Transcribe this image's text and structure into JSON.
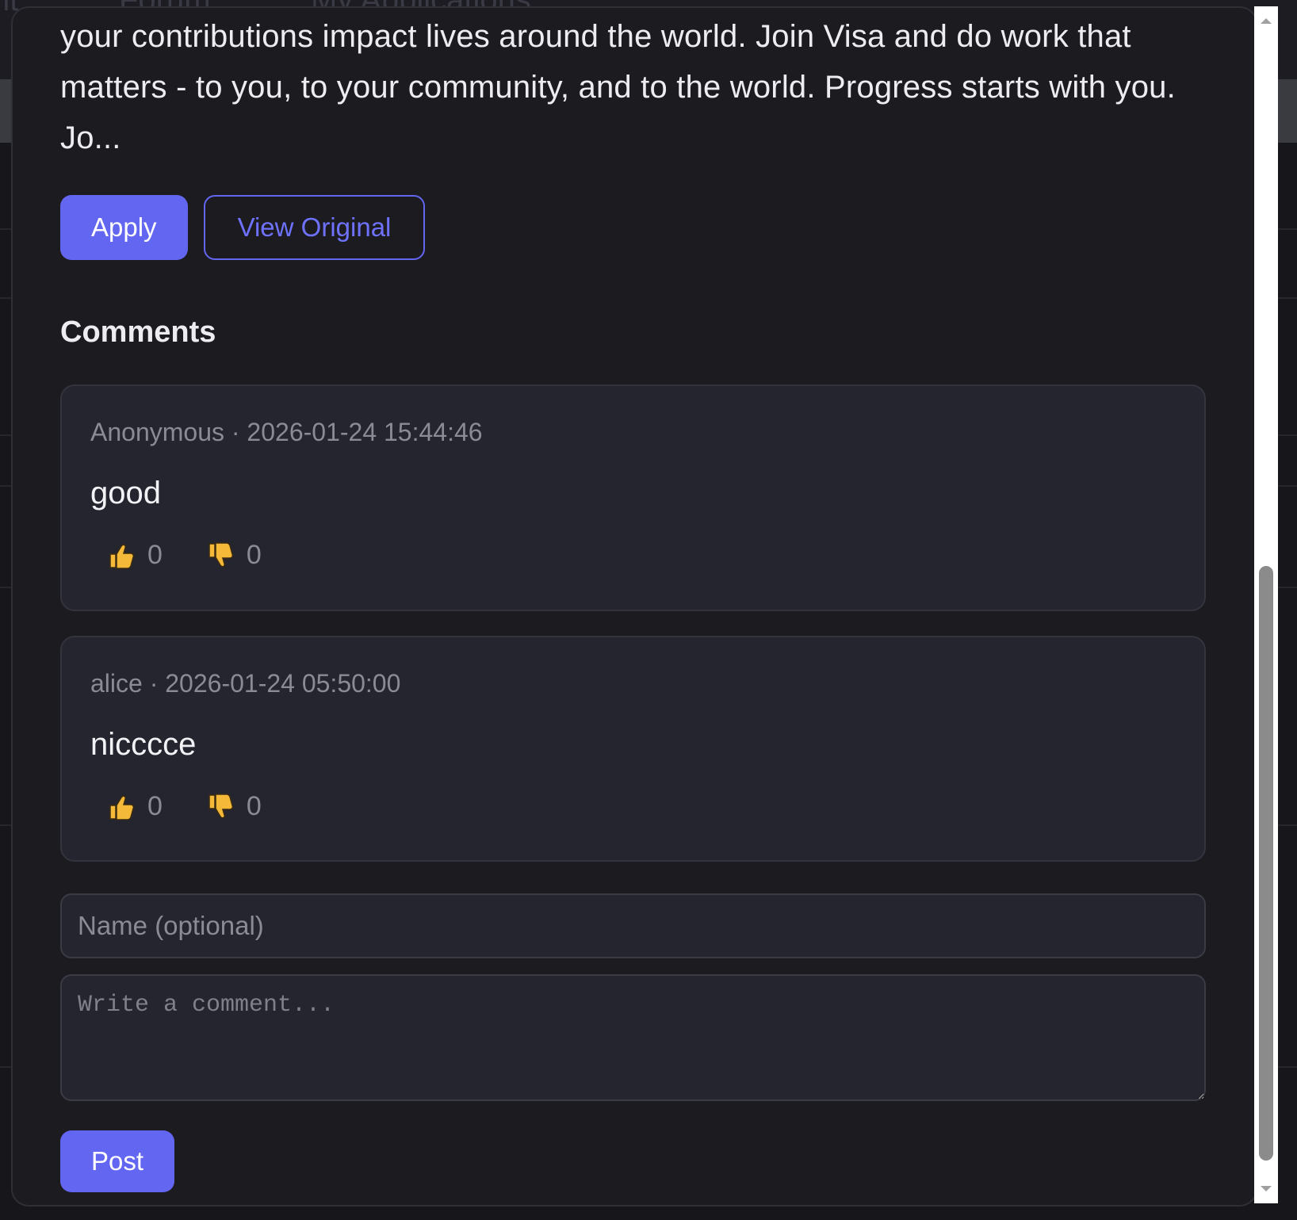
{
  "background": {
    "nav_items": [
      "Forum",
      "My Applications"
    ]
  },
  "job": {
    "description": "your contributions impact lives around the world. Join Visa and do work that matters - to you, to your community, and to the world. Progress starts with you. Jo...",
    "apply_label": "Apply",
    "view_original_label": "View Original"
  },
  "comments": {
    "heading": "Comments",
    "items": [
      {
        "meta": "Anonymous · 2026-01-24 15:44:46",
        "text": "good",
        "likes": "0",
        "dislikes": "0"
      },
      {
        "meta": "alice · 2026-01-24 05:50:00",
        "text": "nicccce",
        "likes": "0",
        "dislikes": "0"
      }
    ]
  },
  "form": {
    "name_placeholder": "Name (optional)",
    "comment_placeholder": "Write a comment...",
    "post_label": "Post"
  },
  "icons": {
    "like": "thumbs-up-icon",
    "dislike": "thumbs-down-icon"
  },
  "colors": {
    "accent": "#6366f1",
    "modal_bg": "#1b1b20",
    "card_bg": "#24252e",
    "emoji_yellow": "#f5b93a"
  }
}
